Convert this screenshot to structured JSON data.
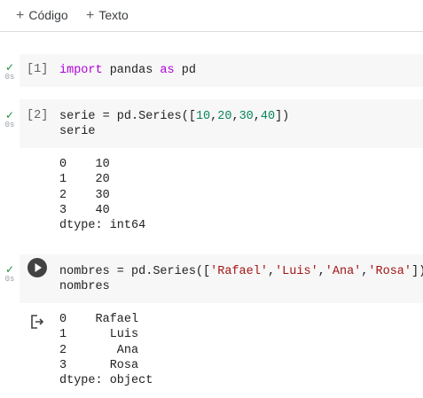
{
  "toolbar": {
    "code_label": "Código",
    "text_label": "Texto"
  },
  "cells": [
    {
      "count": "[1]",
      "time": "0s",
      "code": [
        "import pandas as pd"
      ]
    },
    {
      "count": "[2]",
      "time": "0s",
      "code": [
        "serie = pd.Series([10,20,30,40])",
        "serie"
      ],
      "output": [
        "0    10",
        "1    20",
        "2    30",
        "3    40",
        "dtype: int64"
      ]
    },
    {
      "time": "0s",
      "code": [
        "nombres = pd.Series(['Rafael','Luis','Ana','Rosa'])",
        "nombres"
      ],
      "output": [
        "0    Rafael",
        "1      Luis",
        "2       Ana",
        "3      Rosa",
        "dtype: object"
      ]
    }
  ],
  "colors": {
    "keyword": "#af00db",
    "number": "#098658",
    "string": "#a31515",
    "check": "#1e8e3e",
    "cell_bg": "#f7f7f7"
  },
  "icons": [
    "plus-icon",
    "check-icon",
    "run-icon",
    "output-redirect-icon"
  ]
}
